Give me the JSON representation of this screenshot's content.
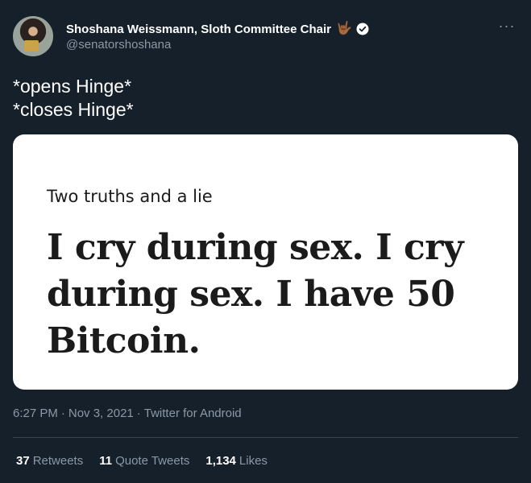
{
  "tweet": {
    "author": {
      "display_name": "Shoshana Weissmann, Sloth Committee Chair",
      "emoji": "🤟🏾",
      "handle": "@senatorshoshana",
      "verified": true
    },
    "text": "*opens Hinge*\n*closes Hinge*",
    "media": {
      "prompt_label": "Two truths and a lie",
      "prompt_answer": "I cry during sex. I cry during sex. I have 50 Bitcoin."
    },
    "meta": {
      "time": "6:27 PM",
      "date": "Nov 3, 2021",
      "source": "Twitter for Android",
      "separator": "·"
    },
    "stats": {
      "retweets": {
        "count": "37",
        "label": "Retweets"
      },
      "quote_tweets": {
        "count": "11",
        "label": "Quote Tweets"
      },
      "likes": {
        "count": "1,134",
        "label": "Likes"
      }
    },
    "icons": {
      "more": "more-options-icon",
      "verified": "verified-badge-icon"
    },
    "colors": {
      "background": "#15202b",
      "secondary_text": "#8b98a5",
      "divider": "#38444d",
      "card": "#ffffff"
    }
  }
}
